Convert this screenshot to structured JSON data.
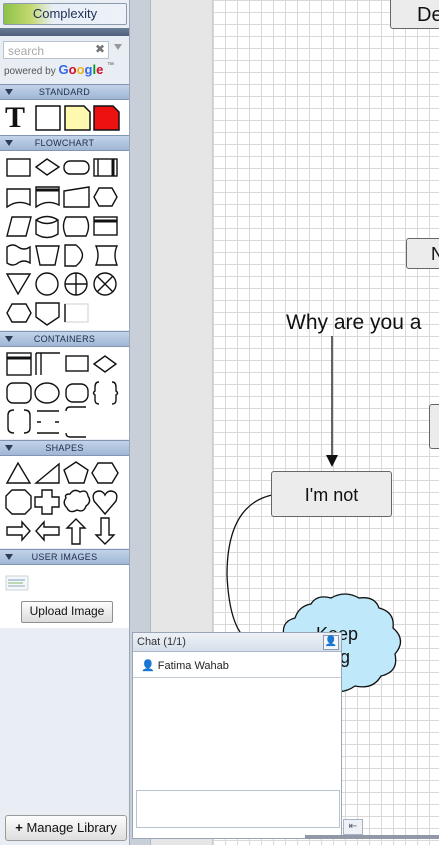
{
  "sidebar": {
    "complexity_label": "Complexity",
    "search_placeholder": "search",
    "search_clear": "✖",
    "powered_by": "powered by",
    "google": "Google",
    "google_tm": "™",
    "sections": {
      "standard": "STANDARD",
      "flowchart": "FLOWCHART",
      "containers": "CONTAINERS",
      "shapes": "SHAPES",
      "user_images": "USER IMAGES"
    },
    "standard_text_glyph": "T",
    "upload_button": "Upload Image",
    "manage_button_plus": "+",
    "manage_button": "Manage Library"
  },
  "canvas": {
    "top_node": "De",
    "right_node_mid": "N",
    "question": "Why are you a",
    "im_not": "I'm not",
    "cloud_line1": "Keep",
    "cloud_line2": "oing"
  },
  "chat": {
    "title": "Chat (1/1)",
    "user": "Fatima Wahab",
    "collapse_glyph": "⇤"
  },
  "colors": {
    "section_header": "#9fb6d4",
    "cloud_fill": "#bfe9fb",
    "note_yellow": "#fff9b0",
    "note_red": "#e11",
    "accent_green": "#8cc34a"
  }
}
